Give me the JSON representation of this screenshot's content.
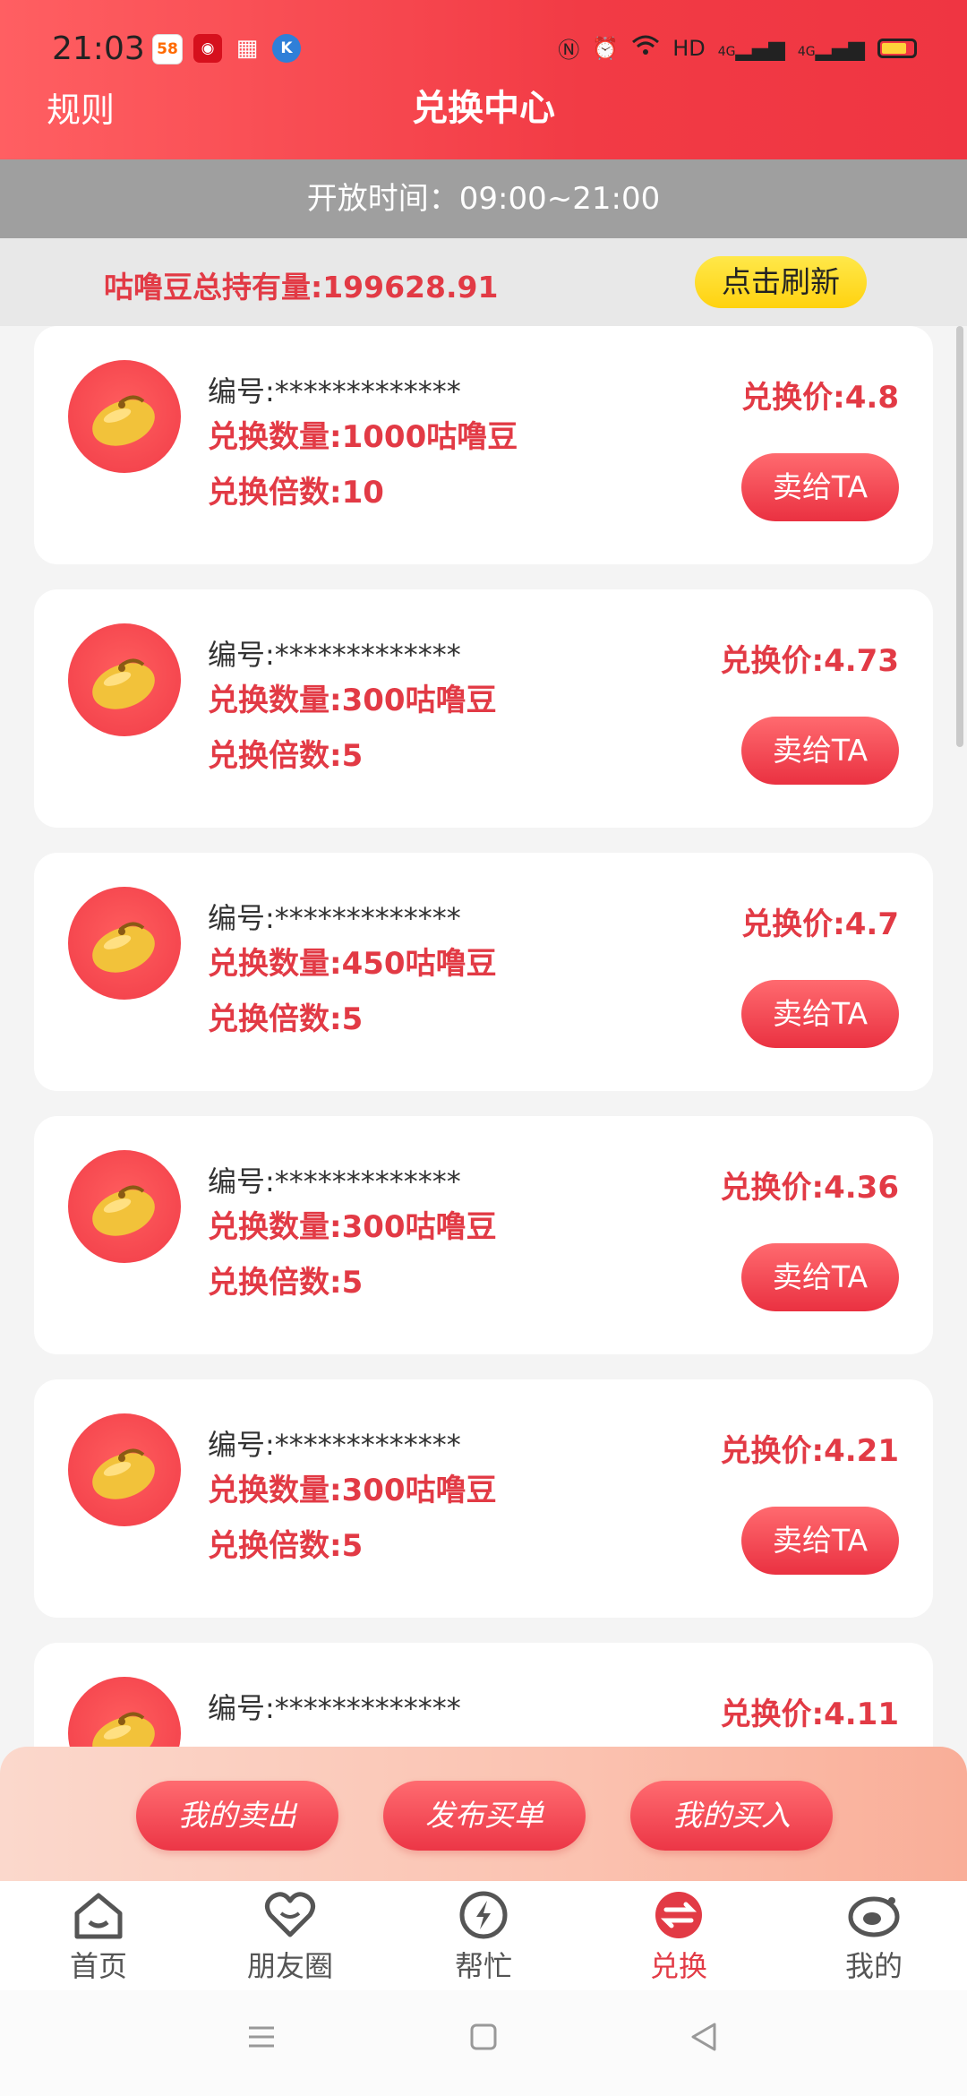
{
  "status_bar": {
    "time": "21:03",
    "app_badges": [
      "58",
      "weibo",
      "grid",
      "K"
    ],
    "network_text": "HD",
    "signal_1": "4G",
    "signal_2": "4G"
  },
  "header": {
    "rules_label": "规则",
    "title": "兑换中心"
  },
  "open_time": "开放时间：09:00~21:00",
  "holding": {
    "text": "咕噜豆总持有量:199628.91",
    "refresh_label": "点击刷新"
  },
  "listings": [
    {
      "code": "编号:*************",
      "quantity": "兑换数量:1000咕噜豆",
      "multiplier": "兑换倍数:10",
      "price": "兑换价:4.8",
      "sell_label": "卖给TA"
    },
    {
      "code": "编号:*************",
      "quantity": "兑换数量:300咕噜豆",
      "multiplier": "兑换倍数:5",
      "price": "兑换价:4.73",
      "sell_label": "卖给TA"
    },
    {
      "code": "编号:*************",
      "quantity": "兑换数量:450咕噜豆",
      "multiplier": "兑换倍数:5",
      "price": "兑换价:4.7",
      "sell_label": "卖给TA"
    },
    {
      "code": "编号:*************",
      "quantity": "兑换数量:300咕噜豆",
      "multiplier": "兑换倍数:5",
      "price": "兑换价:4.36",
      "sell_label": "卖给TA"
    },
    {
      "code": "编号:*************",
      "quantity": "兑换数量:300咕噜豆",
      "multiplier": "兑换倍数:5",
      "price": "兑换价:4.21",
      "sell_label": "卖给TA"
    },
    {
      "code": "编号:*************",
      "quantity": "",
      "multiplier": "",
      "price": "兑换价:4.11",
      "sell_label": ""
    }
  ],
  "actions": {
    "my_sales": "我的卖出",
    "post_buy": "发布买单",
    "my_buys": "我的买入"
  },
  "tabs": [
    {
      "label": "首页",
      "icon": "home-icon"
    },
    {
      "label": "朋友圈",
      "icon": "heart-icon"
    },
    {
      "label": "帮忙",
      "icon": "bolt-icon"
    },
    {
      "label": "兑换",
      "icon": "exchange-icon",
      "active": true
    },
    {
      "label": "我的",
      "icon": "profile-icon"
    }
  ],
  "colors": {
    "accent": "#e23a45",
    "header": "#f23b45",
    "refresh": "#ffd20f"
  }
}
